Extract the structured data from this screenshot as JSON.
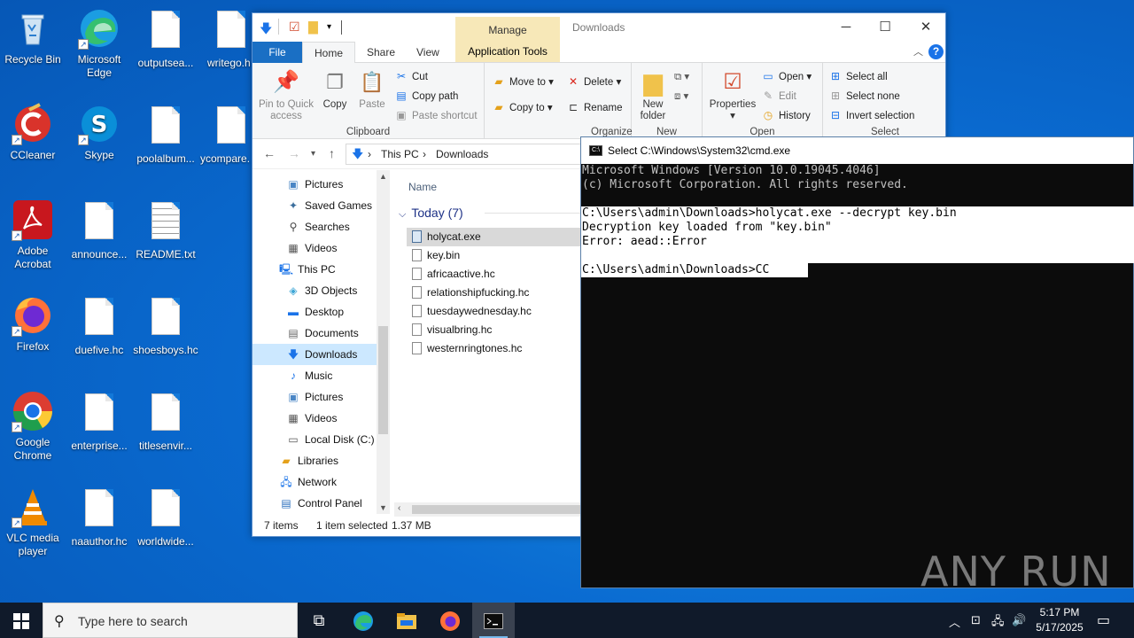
{
  "desktop": {
    "icons": [
      {
        "label": "Recycle Bin"
      },
      {
        "label": "Microsoft Edge"
      },
      {
        "label": "outputsea..."
      },
      {
        "label": "writego.h"
      },
      {
        "label": "CCleaner"
      },
      {
        "label": "Skype"
      },
      {
        "label": "poolalbum..."
      },
      {
        "label": "ycompare."
      },
      {
        "label": "Adobe Acrobat"
      },
      {
        "label": "announce..."
      },
      {
        "label": "README.txt"
      },
      {
        "label": "Firefox"
      },
      {
        "label": "duefive.hc"
      },
      {
        "label": "shoesboys.hc"
      },
      {
        "label": "Google Chrome"
      },
      {
        "label": "enterprise..."
      },
      {
        "label": "titlesenvir..."
      },
      {
        "label": "VLC media player"
      },
      {
        "label": "naauthor.hc"
      },
      {
        "label": "worldwide..."
      }
    ]
  },
  "explorer": {
    "title": "Downloads",
    "manage_label": "Manage",
    "app_tools_label": "Application Tools",
    "tabs": {
      "file": "File",
      "home": "Home",
      "share": "Share",
      "view": "View"
    },
    "ribbon": {
      "clipboard": {
        "label": "Clipboard",
        "pin": "Pin to Quick access",
        "copy": "Copy",
        "paste": "Paste",
        "cut": "Cut",
        "copy_path": "Copy path",
        "paste_shortcut": "Paste shortcut"
      },
      "organize": {
        "label": "Organize",
        "move_to": "Move to",
        "copy_to": "Copy to",
        "delete": "Delete",
        "rename": "Rename"
      },
      "new": {
        "label": "New",
        "new_folder": "New folder"
      },
      "open": {
        "label": "Open",
        "properties": "Properties",
        "open": "Open",
        "edit": "Edit",
        "history": "History"
      },
      "select": {
        "label": "Select",
        "select_all": "Select all",
        "select_none": "Select none",
        "invert": "Invert selection"
      }
    },
    "breadcrumb": [
      "This PC",
      "Downloads"
    ],
    "nav": [
      {
        "label": "Pictures"
      },
      {
        "label": "Saved Games"
      },
      {
        "label": "Searches"
      },
      {
        "label": "Videos"
      },
      {
        "label": "This PC"
      },
      {
        "label": "3D Objects"
      },
      {
        "label": "Desktop"
      },
      {
        "label": "Documents"
      },
      {
        "label": "Downloads"
      },
      {
        "label": "Music"
      },
      {
        "label": "Pictures"
      },
      {
        "label": "Videos"
      },
      {
        "label": "Local Disk (C:)"
      },
      {
        "label": "Libraries"
      },
      {
        "label": "Network"
      },
      {
        "label": "Control Panel"
      }
    ],
    "column_name": "Name",
    "group_label": "Today (7)",
    "files": [
      "holycat.exe",
      "key.bin",
      "africaactive.hc",
      "relationshipfucking.hc",
      "tuesdaywednesday.hc",
      "visualbring.hc",
      "westernringtones.hc"
    ],
    "status": {
      "items": "7 items",
      "selected": "1 item selected",
      "size": "1.37 MB"
    }
  },
  "cmd": {
    "title": "Select C:\\Windows\\System32\\cmd.exe",
    "lines": [
      "Microsoft Windows [Version 10.0.19045.4046]",
      "(c) Microsoft Corporation. All rights reserved.",
      "",
      "C:\\Users\\admin\\Downloads>holycat.exe --decrypt key.bin",
      "Decryption key loaded from \"key.bin\"",
      "Error: aead::Error",
      "",
      "C:\\Users\\admin\\Downloads>CC"
    ],
    "watermark": "ANY RUN"
  },
  "taskbar": {
    "search_placeholder": "Type here to search",
    "time": "5:17 PM",
    "date": "5/17/2025"
  }
}
